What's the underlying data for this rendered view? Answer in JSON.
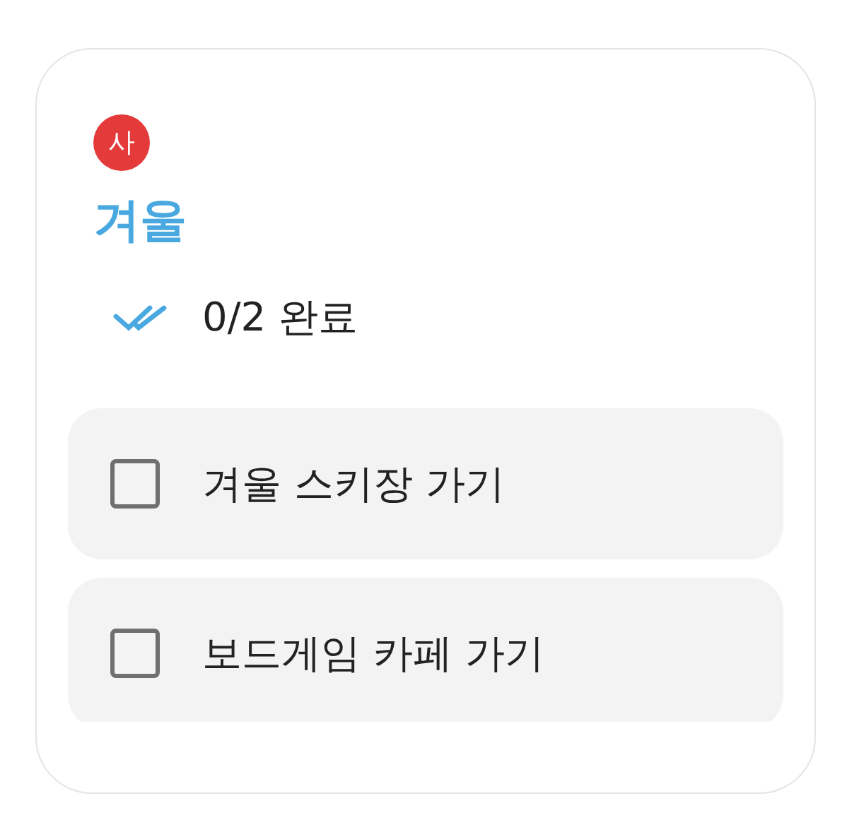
{
  "card": {
    "avatar": "사",
    "title": "겨울",
    "progress": "0/2 완료",
    "tasks": [
      {
        "label": "겨울 스키장 가기",
        "checked": false
      },
      {
        "label": "보드게임 카페 가기",
        "checked": false
      }
    ]
  }
}
